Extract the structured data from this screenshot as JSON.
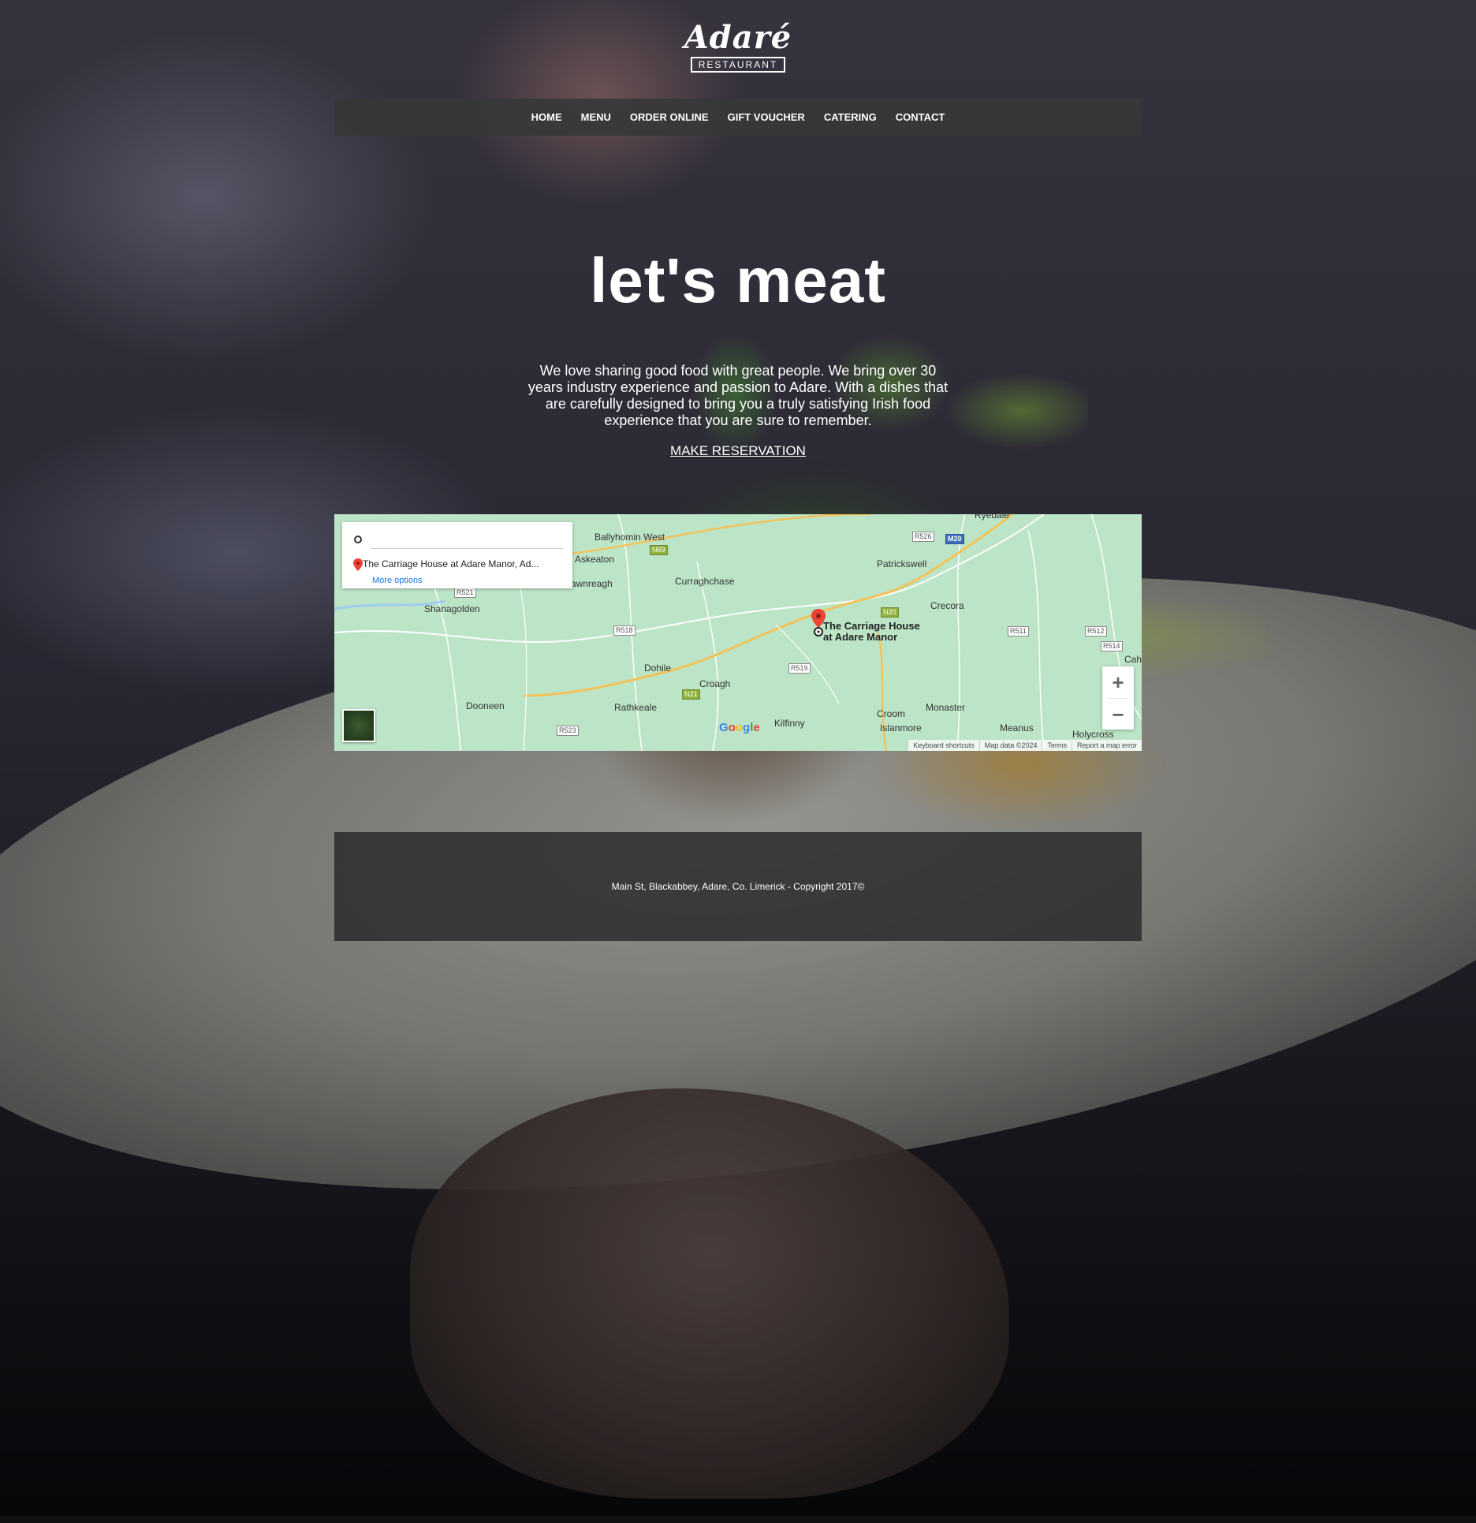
{
  "logo": {
    "word": "Adaré",
    "sub": "RESTAURANT"
  },
  "nav": {
    "items": [
      "HOME",
      "MENU",
      "ORDER ONLINE",
      "GIFT VOUCHER",
      "CATERING",
      "CONTACT"
    ]
  },
  "hero": {
    "title": "let's meat",
    "text": "We love sharing good food with great people. We bring over 30 years industry experience and passion to Adare. With a dishes that are carefully designed to bring you a truly satisfying Irish food experience that you are sure to remember.",
    "cta": "MAKE RESERVATION"
  },
  "map": {
    "destination": "The Carriage House at Adare Manor, Ad...",
    "more_options": "More options",
    "marker_label_line1": "The Carriage House",
    "marker_label_line2": "at Adare Manor",
    "places": [
      "Ballyhomin West",
      "Askeaton",
      "awnreagh",
      "Shanagolden",
      "Curraghchase",
      "Patrickswell",
      "Crecora",
      "Dohile",
      "Croagh",
      "Dooneen",
      "Rathkeale",
      "Kilfinny",
      "Croom",
      "Islanmore",
      "Monaster",
      "Meanus",
      "Holycross",
      "Cahe",
      "Ryedale"
    ],
    "routes": [
      "R521",
      "R518",
      "R519",
      "R523",
      "N69",
      "N21",
      "N20",
      "R526",
      "M20",
      "R511",
      "R512",
      "R514"
    ],
    "zoom_in": "+",
    "zoom_out": "−",
    "attribution": [
      "Keyboard shortcuts",
      "Map data ©2024",
      "Terms",
      "Report a map error"
    ],
    "brand": "Google"
  },
  "footer": {
    "text": "Main St, Blackabbey, Adare, Co. Limerick - Copyright 2017©"
  },
  "icons": [
    "origin-circle-icon",
    "destination-pin-icon",
    "map-marker-icon",
    "satellite-layer-icon"
  ]
}
